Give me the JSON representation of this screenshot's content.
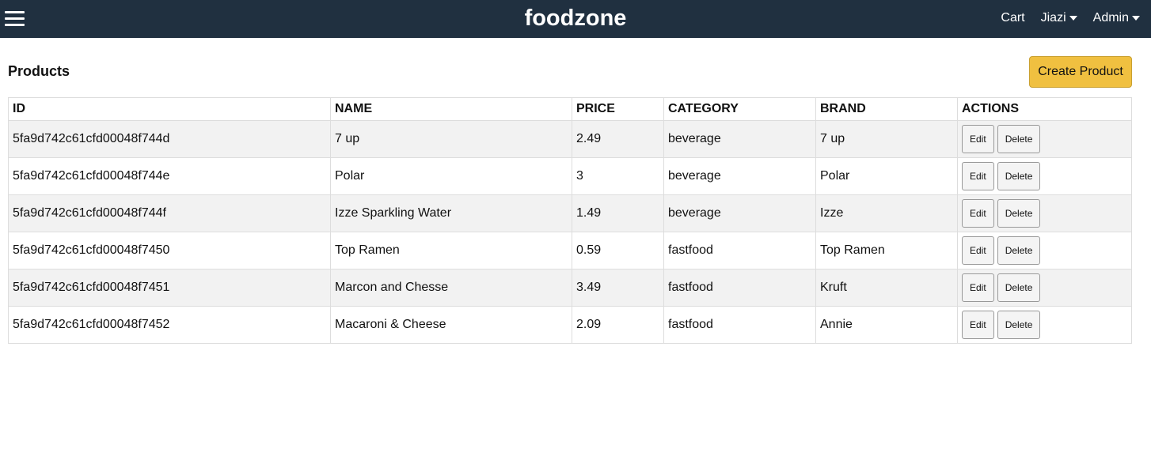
{
  "navbar": {
    "brand": "foodzone",
    "menu_icon": "hamburger-menu-icon",
    "cart_label": "Cart",
    "user_label": "Jiazi",
    "admin_label": "Admin",
    "dropdown_icon": "caret-down-icon"
  },
  "page": {
    "title": "Products",
    "create_button": "Create Product"
  },
  "table": {
    "headers": [
      "ID",
      "NAME",
      "PRICE",
      "CATEGORY",
      "BRAND",
      "ACTIONS"
    ],
    "edit_label": "Edit",
    "delete_label": "Delete",
    "rows": [
      {
        "id": "5fa9d742c61cfd00048f744d",
        "name": "7 up",
        "price": "2.49",
        "category": "beverage",
        "brand": "7 up"
      },
      {
        "id": "5fa9d742c61cfd00048f744e",
        "name": "Polar",
        "price": "3",
        "category": "beverage",
        "brand": "Polar"
      },
      {
        "id": "5fa9d742c61cfd00048f744f",
        "name": "Izze Sparkling Water",
        "price": "1.49",
        "category": "beverage",
        "brand": "Izze"
      },
      {
        "id": "5fa9d742c61cfd00048f7450",
        "name": "Top Ramen",
        "price": "0.59",
        "category": "fastfood",
        "brand": "Top Ramen"
      },
      {
        "id": "5fa9d742c61cfd00048f7451",
        "name": "Marcon and Chesse",
        "price": "3.49",
        "category": "fastfood",
        "brand": "Kruft"
      },
      {
        "id": "5fa9d742c61cfd00048f7452",
        "name": "Macaroni & Cheese",
        "price": "2.09",
        "category": "fastfood",
        "brand": "Annie"
      }
    ]
  },
  "colors": {
    "navbar_bg": "#203040",
    "accent_button": "#f0c040",
    "row_stripe": "#f2f2f2"
  }
}
